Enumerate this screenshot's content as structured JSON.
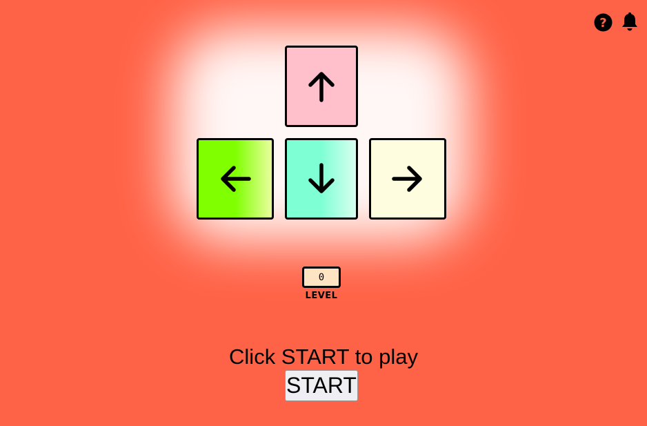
{
  "header": {
    "help_icon": "question-circle-icon",
    "notification_icon": "bell-icon"
  },
  "keys": [
    {
      "direction": "up",
      "icon": "arrow-up-icon",
      "colors": [
        "#ffc0cb",
        "#ffc0cb"
      ]
    },
    {
      "direction": "left",
      "icon": "arrow-left-icon",
      "colors": [
        "#7fff00",
        "#7fff00",
        "#eaff9e"
      ]
    },
    {
      "direction": "down",
      "icon": "arrow-down-icon",
      "colors": [
        "#7fffd4",
        "#7fffd4",
        "#d8fff0"
      ]
    },
    {
      "direction": "right",
      "icon": "arrow-right-icon",
      "colors": [
        "#fffde0",
        "#fffde0"
      ]
    }
  ],
  "level": {
    "value": "0",
    "label": "LEVEL"
  },
  "message": "Click START to play",
  "start_button": {
    "label": "START"
  },
  "colors": {
    "background": "#ff6347",
    "level_box": "#ffe4c4"
  }
}
